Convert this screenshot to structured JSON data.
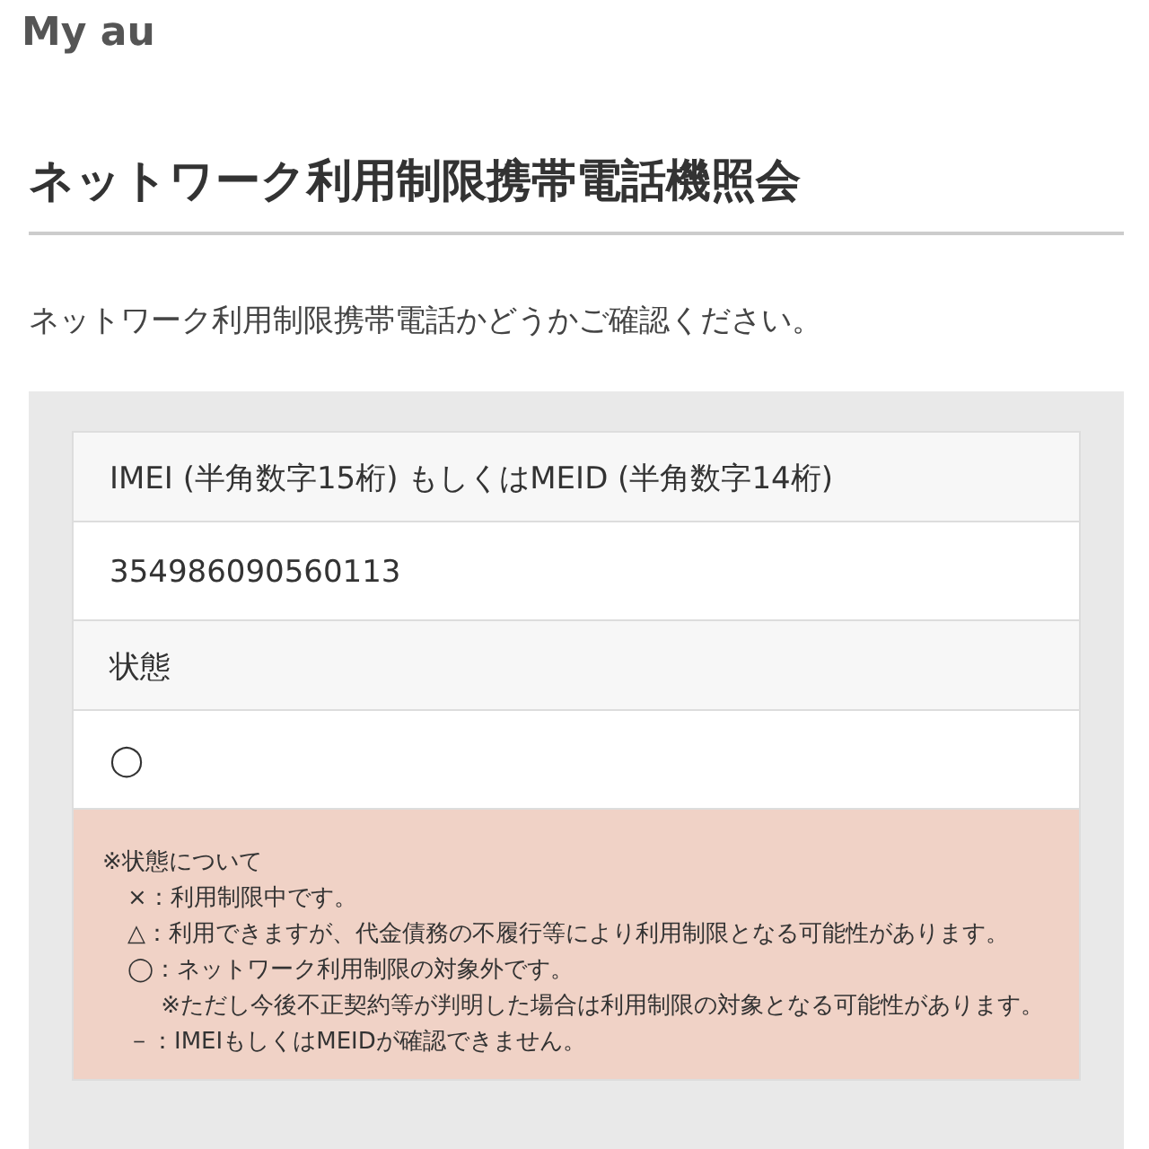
{
  "header": {
    "logo": "My au"
  },
  "title": "ネットワーク利用制限携帯電話機照会",
  "description": "ネットワーク利用制限携帯電話かどうかご確認ください。",
  "fields": [
    {
      "label": "IMEI (半角数字15桁) もしくはMEID (半角数字14桁)",
      "value": "354986090560113"
    },
    {
      "label": "状態",
      "value": "◯"
    }
  ],
  "notes": {
    "heading": "※状態について",
    "items": [
      {
        "mark": "×",
        "text": "：利用制限中です。"
      },
      {
        "mark": "△",
        "text": "：利用できますが、代金債務の不履行等により利用制限となる可能性があります。"
      },
      {
        "mark": "◯",
        "text": "：ネットワーク利用制限の対象外です。",
        "sub": "※ただし今後不正契約等が判明した場合は利用制限の対象となる可能性があります。"
      },
      {
        "mark": "－",
        "text": "：IMEIもしくはMEIDが確認できません。"
      }
    ]
  }
}
